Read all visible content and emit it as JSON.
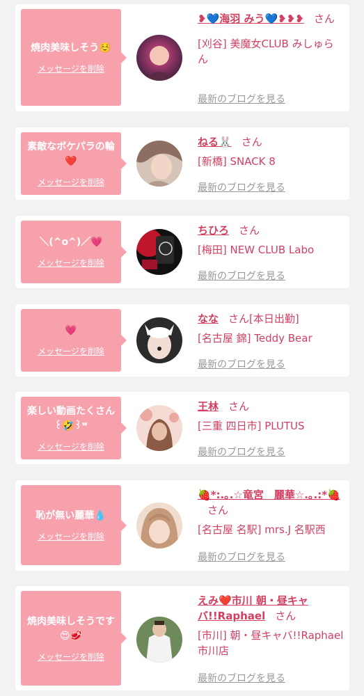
{
  "items": [
    {
      "message": "焼肉美味しそう☺️",
      "delete_label": "メッセージを削除",
      "name": "❥💙海羽 みう💙❥❥❥",
      "honorific": "さん",
      "status": "",
      "shop": "[刈谷] 美魔女CLUB みしゅらん",
      "blog_link": "最新のブログを見る",
      "avatar_colors": [
        "#3a1f3c",
        "#e24a8a"
      ]
    },
    {
      "message": "素敵なボケパラの輪❤️",
      "delete_label": "メッセージを削除",
      "name": "ねる🐰",
      "honorific": "さん",
      "status": "",
      "shop": "[新橋] SNACK 8",
      "blog_link": "最新のブログを見る",
      "avatar_colors": [
        "#8d6e63",
        "#d7c4b8"
      ]
    },
    {
      "message": "＼(^o^)／💗",
      "delete_label": "メッセージを削除",
      "name": "ちひろ",
      "honorific": "さん",
      "status": "",
      "shop": "[梅田] NEW CLUB Labo",
      "blog_link": "最新のブログを見る",
      "avatar_colors": [
        "#111111",
        "#c0162b"
      ]
    },
    {
      "message": "💗",
      "delete_label": "メッセージを削除",
      "name": "なな",
      "honorific": "さん",
      "status": "[本日出勤]",
      "shop": "[名古屋 錦] Teddy Bear",
      "blog_link": "最新のブログを見る",
      "avatar_colors": [
        "#2b2b2b",
        "#e8d7d0"
      ]
    },
    {
      "message": "楽しい動画たくさん꒰🤣꒱ʷ",
      "delete_label": "メッセージを削除",
      "name": "王林",
      "honorific": "さん",
      "status": "",
      "shop": "[三重 四日市] PLUTUS",
      "blog_link": "最新のブログを見る",
      "avatar_colors": [
        "#e9c3b8",
        "#8a5a44"
      ]
    },
    {
      "message": "恥が無い麗華💧",
      "delete_label": "メッセージを削除",
      "name": "🍓*:.｡.☆竜宮　麗華☆.｡.:*🍓",
      "honorific": "さん",
      "status": "",
      "shop": "[名古屋 名駅] mrs.J 名駅西",
      "blog_link": "最新のブログを見る",
      "avatar_colors": [
        "#c49a7a",
        "#f0ddd0"
      ]
    },
    {
      "message": "焼肉美味しそうです😍🥩",
      "delete_label": "メッセージを削除",
      "name": "えみ❤️市川 朝・昼キャバ!!Raphael",
      "honorific": "さん",
      "status": "",
      "shop": "[市川] 朝・昼キャバ!!Raphael 市川店",
      "blog_link": "最新のブログを見る",
      "avatar_colors": [
        "#6f8a5a",
        "#f3f3f3"
      ]
    }
  ]
}
